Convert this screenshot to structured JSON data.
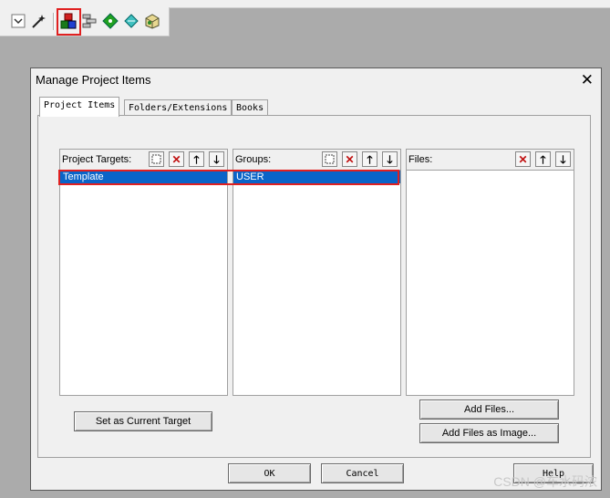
{
  "toolbar": {
    "icons": [
      "checkbox-dropdown-icon",
      "wand-icon",
      "manage-project-items-icon",
      "component-stack-icon",
      "diamond-green-icon",
      "diamond-cyan-icon",
      "pack-installer-icon"
    ]
  },
  "dialog": {
    "title": "Manage Project Items",
    "close_glyph": "✕",
    "tabs": [
      {
        "label": "Project Items",
        "active": true
      },
      {
        "label": "Folders/Extensions",
        "active": false
      },
      {
        "label": "Books",
        "active": false
      }
    ],
    "panels": {
      "targets": {
        "label": "Project Targets:",
        "items": [
          "Template"
        ]
      },
      "groups": {
        "label": "Groups:",
        "items": [
          "USER"
        ]
      },
      "files": {
        "label": "Files:",
        "items": []
      }
    },
    "buttons": {
      "set_current_target": "Set as Current Target",
      "add_files": "Add Files...",
      "add_files_image": "Add Files as Image...",
      "ok": "OK",
      "cancel": "Cancel",
      "help": "Help"
    }
  },
  "watermark": "CSDN @车水码浓",
  "colors": {
    "selection": "#0a64c8",
    "highlight": "#e02020",
    "dialog_bg": "#f0f0f0",
    "backdrop": "#ababab"
  }
}
